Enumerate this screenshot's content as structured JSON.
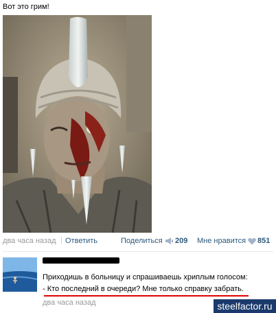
{
  "post": {
    "text": "Вот это грим!",
    "time": "два часа назад",
    "separator": "|",
    "reply_label": "Ответить",
    "share_label": "Поделиться",
    "share_count": "209",
    "like_label": "Мне нравится",
    "like_count": "851"
  },
  "comment": {
    "author": "",
    "line1": "Приходишь в больницу и спрашиваешь хриплым голосом:",
    "line2": "- Кто последний в очереди? Мне только справку забрать.",
    "time": "два часа назад"
  },
  "watermark": "steelfactor.ru",
  "colors": {
    "link": "#2b587a",
    "muted": "#999999",
    "underline": "#e00000",
    "watermark_bg": "#1b3a6c"
  },
  "icons": {
    "share": "megaphone-icon",
    "like": "heart-icon"
  }
}
